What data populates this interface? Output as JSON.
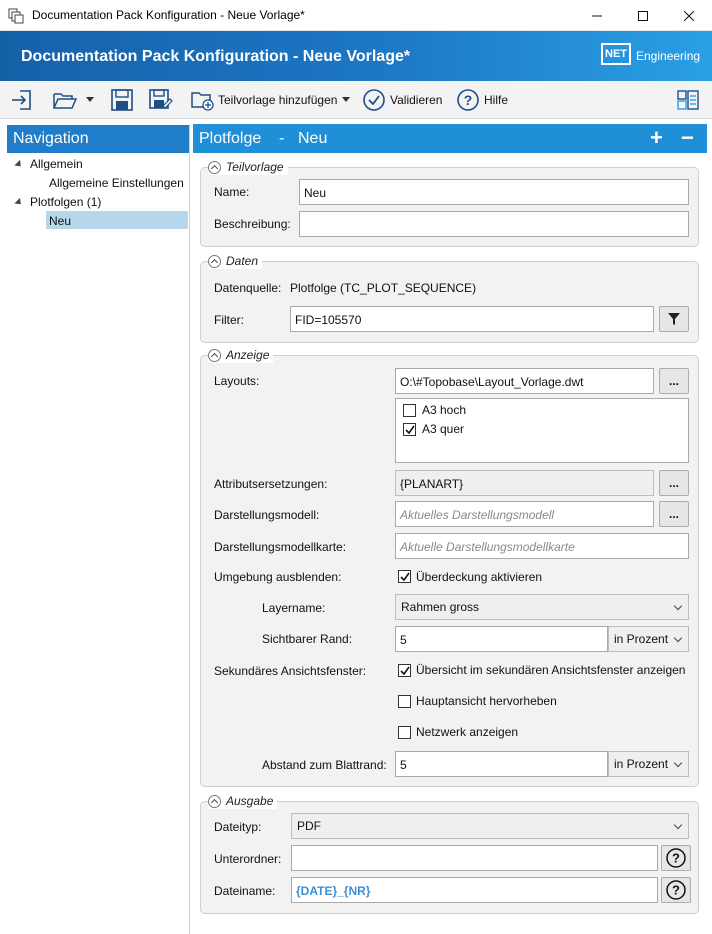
{
  "window": {
    "title": "Documentation Pack Konfiguration - Neue Vorlage*",
    "minimize": "─",
    "maximize": "☐",
    "close": "✕"
  },
  "banner": {
    "title": "Documentation Pack Konfiguration - Neue Vorlage*",
    "logo_box": "NET",
    "logo_text": "Engineering"
  },
  "toolbar": {
    "add_subtemplate": "Teilvorlage hinzufügen",
    "validate": "Validieren",
    "help": "Hilfe"
  },
  "navigation": {
    "header": "Navigation",
    "items": [
      {
        "label": "Allgemein",
        "level": 0
      },
      {
        "label": "Allgemeine Einstellungen",
        "level": 1
      },
      {
        "label": "Plotfolgen (1)",
        "level": 0
      },
      {
        "label": "Neu",
        "level": 1,
        "selected": true
      }
    ]
  },
  "panel": {
    "title": "Plotfolge",
    "separator": "-",
    "name": "Neu",
    "add": "+",
    "remove": "−"
  },
  "teilvorlage": {
    "title": "Teilvorlage",
    "name_label": "Name:",
    "name_value": "Neu",
    "desc_label": "Beschreibung:",
    "desc_value": ""
  },
  "daten": {
    "title": "Daten",
    "source_label": "Datenquelle:",
    "source_value": "Plotfolge (TC_PLOT_SEQUENCE)",
    "filter_label": "Filter:",
    "filter_value": "FID=105570"
  },
  "anzeige": {
    "title": "Anzeige",
    "layouts_label": "Layouts:",
    "layouts_value": "O:\\#Topobase\\Layout_Vorlage.dwt",
    "browse": "...",
    "layout_options": [
      {
        "label": "A3 hoch",
        "checked": false
      },
      {
        "label": "A3 quer",
        "checked": true
      }
    ],
    "attr_label": "Attributsersetzungen:",
    "attr_value": "{PLANART}",
    "model_label": "Darstellungsmodell:",
    "model_placeholder": "Aktuelles Darstellungsmodell",
    "modelmap_label": "Darstellungsmodellkarte:",
    "modelmap_placeholder": "Aktuelle Darstellungsmodellkarte",
    "hide_env_label": "Umgebung ausblenden:",
    "overlay_label": "Überdeckung aktivieren",
    "overlay_checked": true,
    "layer_label": "Layername:",
    "layer_value": "Rahmen gross",
    "border_label": "Sichtbarer Rand:",
    "border_value": "5",
    "border_unit": "in Prozent",
    "secondary_label": "Sekundäres Ansichtsfenster:",
    "overview_label": "Übersicht im sekundären Ansichtsfenster anzeigen",
    "overview_checked": true,
    "highlight_label": "Hauptansicht hervorheben",
    "highlight_checked": false,
    "network_label": "Netzwerk anzeigen",
    "network_checked": false,
    "margin_label": "Abstand zum Blattrand:",
    "margin_value": "5",
    "margin_unit": "in Prozent"
  },
  "ausgabe": {
    "title": "Ausgabe",
    "filetype_label": "Dateityp:",
    "filetype_value": "PDF",
    "subfolder_label": "Unterordner:",
    "subfolder_value": "",
    "filename_label": "Dateiname:",
    "filename_value": "{DATE}_{NR}"
  },
  "colors": {
    "banner": "#1d78c6",
    "panel_header": "#1f8fd8",
    "nav_selection": "#b6d7ea",
    "accent_text": "#3d8fd4"
  }
}
